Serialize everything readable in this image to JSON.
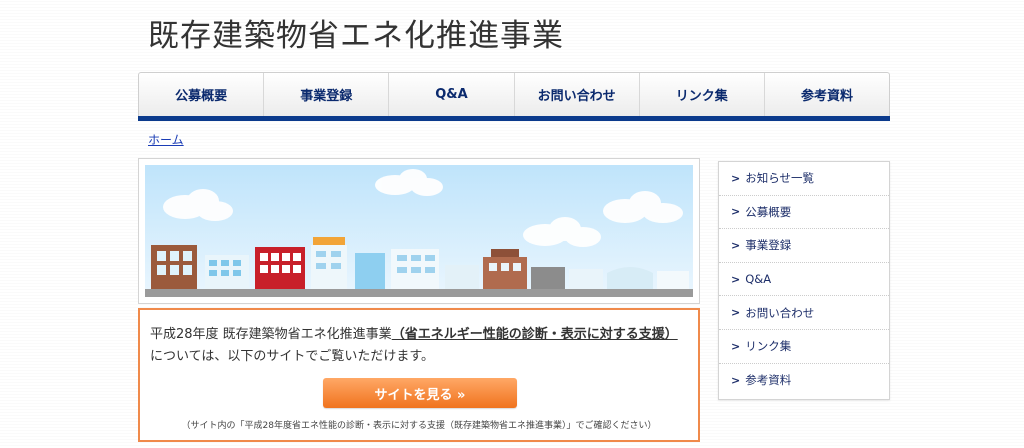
{
  "site": {
    "title": "既存建築物省エネ化推進事業"
  },
  "gnav": [
    {
      "label": "公募概要"
    },
    {
      "label": "事業登録"
    },
    {
      "label": "Q&A"
    },
    {
      "label": "お問い合わせ"
    },
    {
      "label": "リンク集"
    },
    {
      "label": "参考資料"
    }
  ],
  "breadcrumb": {
    "home": "ホーム"
  },
  "notice": {
    "text_pre": "平成28年度 既存建築物省エネ化推進事業",
    "text_link": "（省エネルギー性能の診断・表示に対する支援）",
    "text_post": "については、以下のサイトでご覧いただけます。",
    "button_label": "サイトを見る »",
    "note": "（サイト内の「平成28年度省エネ性能の診断・表示に対する支援（既存建築物省エネ推進事業）」でご確認ください）"
  },
  "side_nav": [
    {
      "label": "お知らせ一覧"
    },
    {
      "label": "公募概要"
    },
    {
      "label": "事業登録"
    },
    {
      "label": "Q&A"
    },
    {
      "label": "お問い合わせ"
    },
    {
      "label": "リンク集"
    },
    {
      "label": "参考資料"
    }
  ],
  "colors": {
    "nav_text": "#0b2a6e",
    "nav_bar": "#0b3a8c",
    "accent_orange": "#f08a4b",
    "link": "#1a3cb5"
  }
}
